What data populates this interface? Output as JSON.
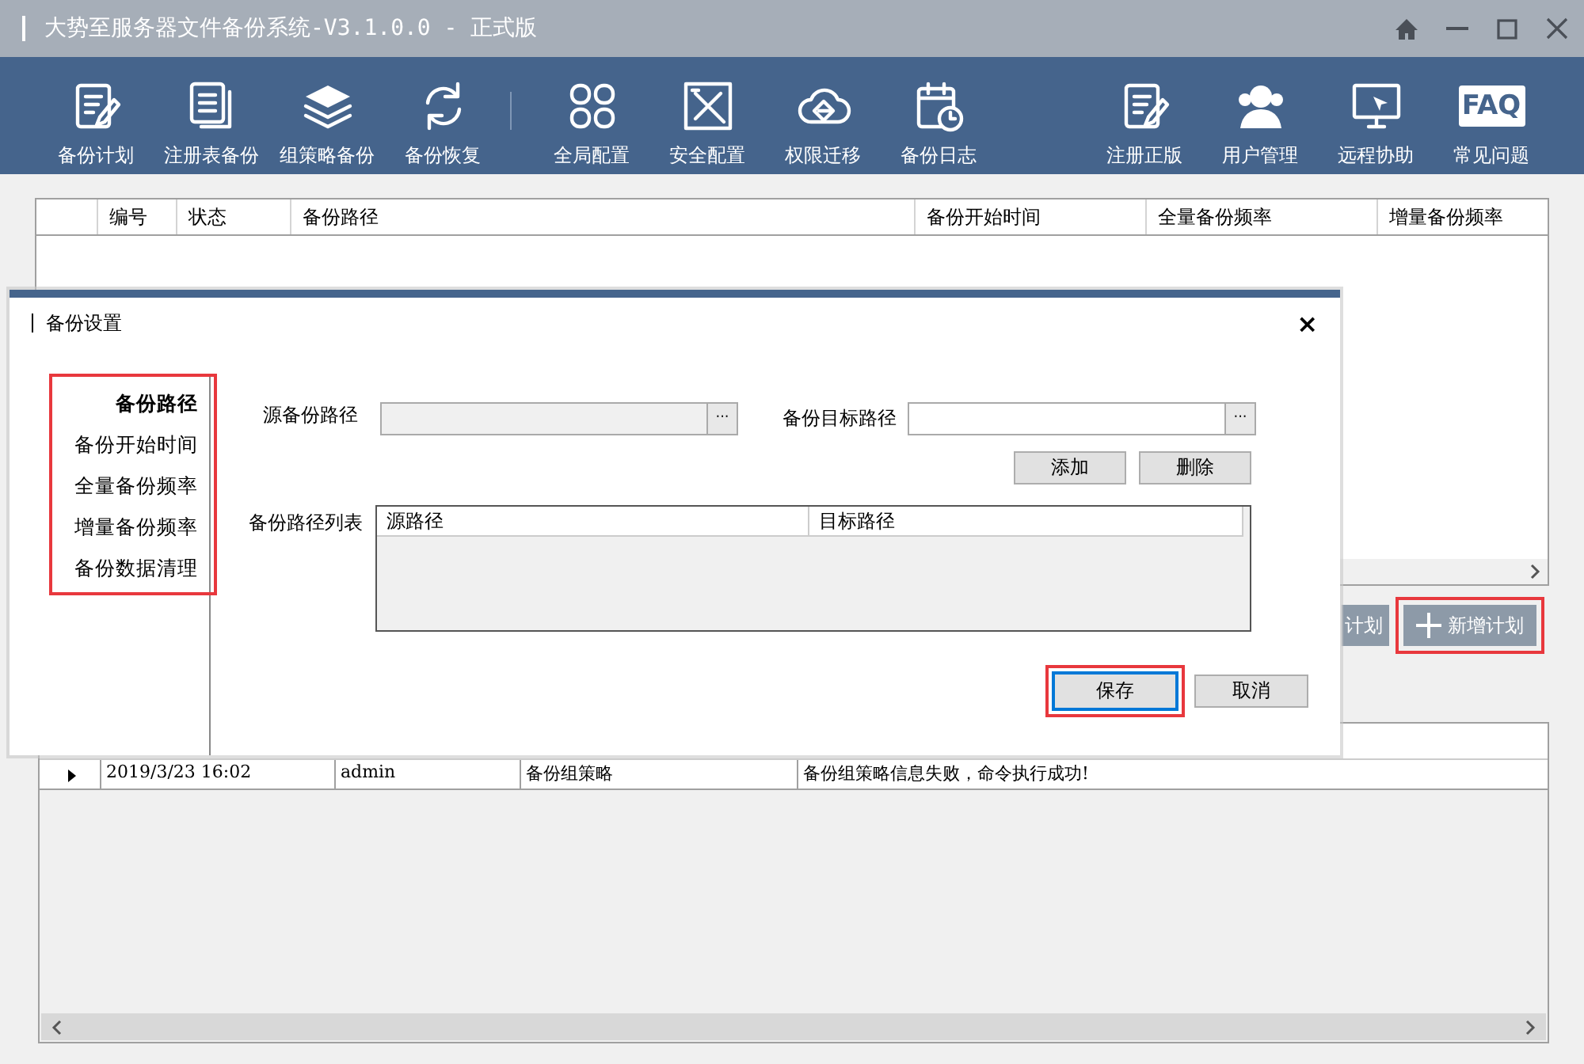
{
  "window": {
    "title": "大势至服务器文件备份系统-V3.1.0.0 - 正式版"
  },
  "toolbar_groups": [
    {
      "items": [
        {
          "label": "备份计划"
        },
        {
          "label": "注册表备份"
        },
        {
          "label": "组策略备份"
        },
        {
          "label": "备份恢复"
        }
      ]
    },
    {
      "items": [
        {
          "label": "全局配置"
        },
        {
          "label": "安全配置"
        },
        {
          "label": "权限迁移"
        },
        {
          "label": "备份日志"
        }
      ]
    },
    {
      "items": [
        {
          "label": "注册正版"
        },
        {
          "label": "用户管理"
        },
        {
          "label": "远程协助"
        },
        {
          "label": "常见问题",
          "icon_text": "FAQ"
        }
      ]
    }
  ],
  "plan_table": {
    "columns": [
      "编号",
      "状态",
      "备份路径",
      "备份开始时间",
      "全量备份频率",
      "增量备份频率"
    ]
  },
  "plan_buttons": [
    {
      "label": "计划",
      "highlighted": false
    },
    {
      "label": "新增计划",
      "highlighted": true
    }
  ],
  "log_table": {
    "rows": [
      {
        "current": true,
        "cells": [
          "2019/3/23 16:02",
          "admin",
          "备份组策略",
          "备份组策略信息失败，命令执行成功!"
        ]
      }
    ]
  },
  "dialog": {
    "title": "备份设置",
    "close": "×",
    "nav": {
      "highlighted": true,
      "items": [
        {
          "label": "备份路径",
          "selected": true
        },
        {
          "label": "备份开始时间",
          "selected": false
        },
        {
          "label": "全量备份频率",
          "selected": false
        },
        {
          "label": "增量备份频率",
          "selected": false
        },
        {
          "label": "备份数据清理",
          "selected": false
        }
      ]
    },
    "source": {
      "label": "源备份路径",
      "disabled": true,
      "browse": "···"
    },
    "target": {
      "label": "备份目标路径",
      "disabled": false,
      "browse": "···"
    },
    "add": "添加",
    "delete": "删除",
    "list": {
      "label": "备份路径列表",
      "columns": [
        "源路径",
        "目标路径"
      ]
    },
    "save": {
      "label": "保存",
      "highlighted": true
    },
    "cancel": "取消"
  }
}
